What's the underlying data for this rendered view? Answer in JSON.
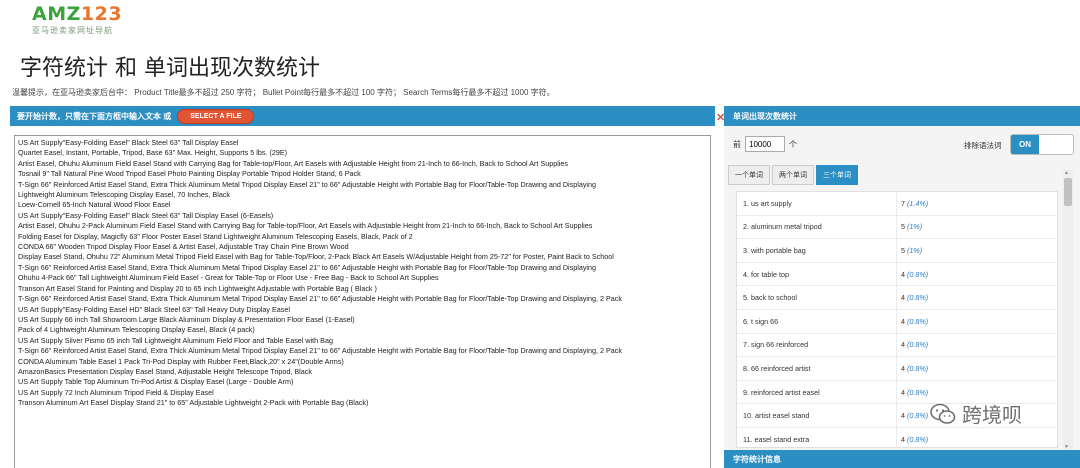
{
  "logo": {
    "brand_a": "AMZ",
    "brand_b": "123",
    "subtitle": "亚马逊卖家网址导航"
  },
  "page_title": "字符统计 和 单词出现次数统计",
  "hint": "温馨提示，在亚马逊卖家后台中： Product Title最多不超过 250 字符； Bullet Point每行最多不超过 100 字符； Search Terms每行最多不超过 1000 字符。",
  "left_panel": {
    "header": "要开始计数，只需在下面方框中输入文本 或",
    "select_file": "SELECT A FILE",
    "lines": [
      "US Art Supply\"Easy-Folding Easel\" Black Steel 63\" Tall Display Easel",
      "Quartet Easel, Instant, Portable, Tripod, Base 63\" Max. Height, Supports 5 lbs. (29E)",
      "Artist Easel, Ohuhu Aluminum Field Easel Stand with Carrying Bag for Table-top/Floor, Art Easels with Adjustable Height from 21-Inch to 66-Inch, Back to School Art Supplies",
      "Tosnail 9\" Tall Natural Pine Wood Tripod Easel Photo Painting Display Portable Tripod Holder Stand, 6 Pack",
      "T-Sign 66\" Reinforced Artist Easel Stand, Extra Thick Aluminum Metal Tripod Display Easel 21\" to 66\" Adjustable Height with Portable Bag for Floor/Table-Top Drawing and Displaying",
      "Lightweight Aluminum Telescoping Display Easel, 70 Inches, Black",
      "Loew-Cornell 65-Inch Natural Wood Floor Easel",
      "US Art Supply\"Easy-Folding Easel\" Black Steel 63\" Tall Display Easel (6-Easels)",
      "Artist Easel, Ohuhu 2-Pack Aluminum Field Easel Stand with Carrying Bag for Table-top/Floor, Art Easels with Adjustable Height from 21-Inch to 66-Inch, Back to School Art Supplies",
      "Folding Easel for Display, Magicfly 63\" Floor Poster Easel Stand Lightweight Aluminum Telescoping Easels, Black, Pack of 2",
      "CONDA 66\" Wooden Tripod Display Floor Easel & Artist Easel, Adjustable Tray Chain Pine Brown Wood",
      "Display Easel Stand, Ohuhu 72\" Aluminum Metal Tripod Field Easel with Bag for Table-Top/Floor, 2-Pack Black Art Easels W/Adjustable Height from 25-72\" for Poster, Paint Back to School",
      "T-Sign 66\" Reinforced Artist Easel Stand, Extra Thick Aluminum Metal Tripod Display Easel 21\" to 66\" Adjustable Height with Portable Bag for Floor/Table-Top Drawing and Displaying",
      "Ohuhu 4-Pack 66\" Tall Lightweight Aluminum Field Easel - Great for Table-Top or Floor Use - Free Bag - Back to School Art Supplies",
      "Transon Art Easel Stand for Painting and Display 20 to 65 inch Lightweight Adjustable with Portable Bag ( Black )",
      "T-Sign 66\" Reinforced Artist Easel Stand, Extra Thick Aluminum Metal Tripod Display Easel 21\" to 66\" Adjustable Height with Portable Bag for Floor/Table-Top Drawing and Displaying, 2 Pack",
      "US Art Supply\"Easy-Folding Easel HD\" Black Steel 63\" Tall Heavy Duty Display Easel",
      "US Art Supply 66 inch Tall Showroom Large Black Aluminum Display & Presentation Floor Easel (1-Easel)",
      "Pack of 4 Lightweight Aluminum Telescoping Display Easel, Black (4 pack)",
      "US Art Supply Silver Pismo 65 inch Tall Lightweight Aluminum Field Floor and Table Easel with Bag",
      "T-Sign 66\" Reinforced Artist Easel Stand, Extra Thick Aluminum Metal Tripod Display Easel 21\" to 66\" Adjustable Height with Portable Bag for Floor/Table-Top Drawing and Displaying, 2 Pack",
      "CONDA Aluminum Table Easel 1 Pack Tri-Pod Display with Rubber Feet,Black,20\" x 24\"(Double Arms)",
      "AmazonBasics Presentation Display Easel Stand, Adjustable Height Telescope Tripod, Black",
      "US Art Supply Table Top Aluminum Tri-Pod Artist & Display Easel (Large - Double Arm)",
      "US Art Supply 72 Inch Aluminum Tripod Field & Display Easel",
      "Transon Aluminum Art Easel Display Stand 21\" to 65\" Adjustable Lightweight 2-Pack with Portable Bag (Black)"
    ]
  },
  "close_icon": "✕",
  "right_panel": {
    "header": "单词出现次数统计",
    "top_n_prefix": "前",
    "top_n_value": "10000",
    "top_n_suffix": "个",
    "filter_label": "排除语法词",
    "toggle_label": "ON",
    "tabs": [
      "一个单词",
      "两个单词",
      "三个单词"
    ],
    "active_tab": 2,
    "rows": [
      {
        "phrase": "1. us art supply",
        "count": "7",
        "pct": "(1.4%)"
      },
      {
        "phrase": "2. aluminum metal tripod",
        "count": "5",
        "pct": "(1%)"
      },
      {
        "phrase": "3. with portable bag",
        "count": "5",
        "pct": "(1%)"
      },
      {
        "phrase": "4. for table top",
        "count": "4",
        "pct": "(0.8%)"
      },
      {
        "phrase": "5. back to school",
        "count": "4",
        "pct": "(0.8%)"
      },
      {
        "phrase": "6. t sign 66",
        "count": "4",
        "pct": "(0.8%)"
      },
      {
        "phrase": "7. sign 66 reinforced",
        "count": "4",
        "pct": "(0.8%)"
      },
      {
        "phrase": "8. 66 reinforced artist",
        "count": "4",
        "pct": "(0.8%)"
      },
      {
        "phrase": "9. reinforced artist easel",
        "count": "4",
        "pct": "(0.8%)"
      },
      {
        "phrase": "10. artist easel stand",
        "count": "4",
        "pct": "(0.8%)"
      },
      {
        "phrase": "11. easel stand extra",
        "count": "4",
        "pct": "(0.8%)"
      }
    ],
    "bottom_header": "字符统计信息"
  },
  "watermark": {
    "text": "跨境呗",
    "icon": "wechat-icon"
  },
  "colors": {
    "accent": "#2b8fc4",
    "button": "#e25534",
    "logo_green": "#3aa33a",
    "logo_orange": "#e8762c"
  }
}
